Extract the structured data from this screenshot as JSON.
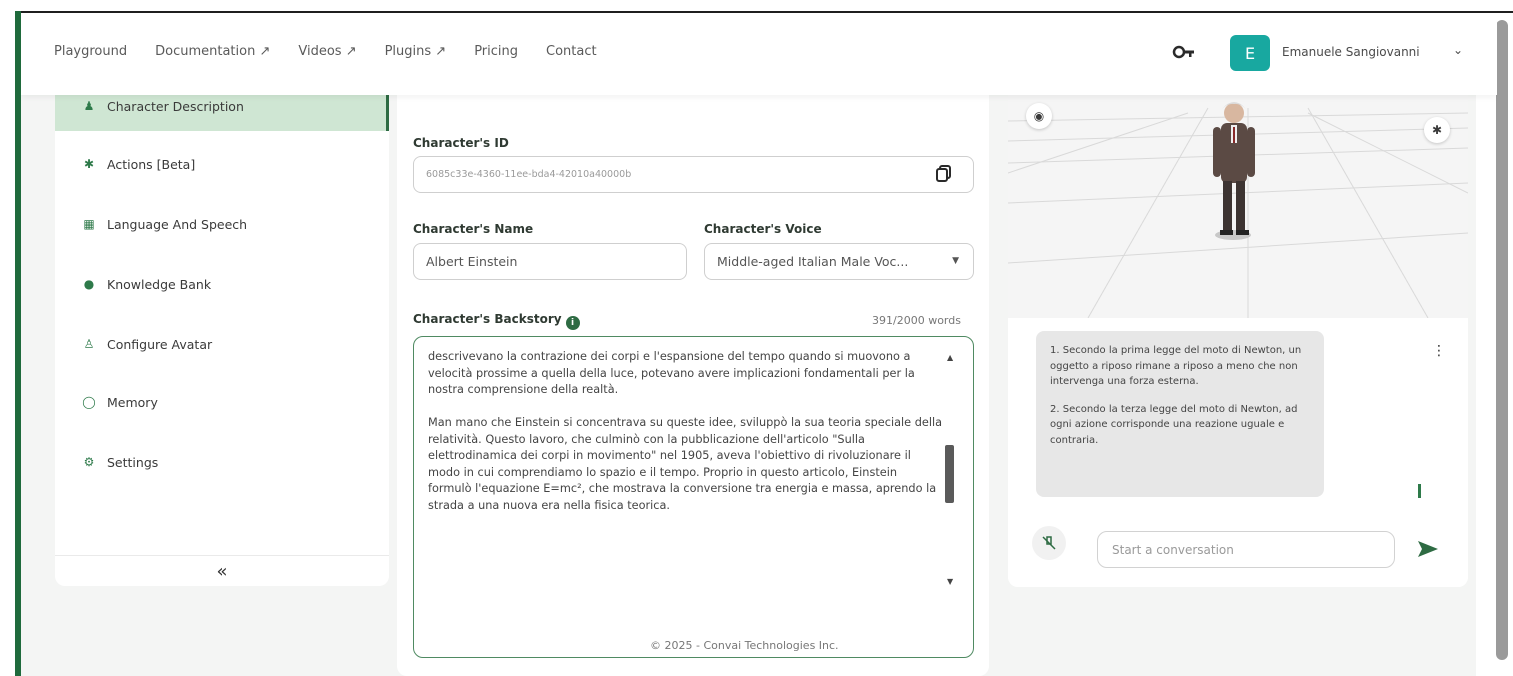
{
  "nav": {
    "links": [
      "Playground",
      "Documentation ↗",
      "Videos ↗",
      "Plugins ↗",
      "Pricing",
      "Contact"
    ],
    "user_initial": "E",
    "user_name": "Emanuele Sangiovanni",
    "avatar_color": "#18a8a0"
  },
  "sidebar": {
    "items": [
      {
        "label": "Character Description",
        "icon": "person-icon",
        "active": true
      },
      {
        "label": "Actions [Beta]",
        "icon": "running-icon",
        "active": false
      },
      {
        "label": "Language And Speech",
        "icon": "language-icon",
        "active": false
      },
      {
        "label": "Knowledge Bank",
        "icon": "lightbulb-icon",
        "active": false
      },
      {
        "label": "Configure Avatar",
        "icon": "avatar-icon",
        "active": false
      },
      {
        "label": "Memory",
        "icon": "memory-icon",
        "active": false
      },
      {
        "label": "Settings",
        "icon": "gear-icon",
        "active": false
      }
    ],
    "collapse_label": "«"
  },
  "form": {
    "id_label": "Character's ID",
    "id_value": "6085c33e-4360-11ee-bda4-42010a40000b",
    "name_label": "Character's Name",
    "name_value": "Albert Einstein",
    "voice_label": "Character's Voice",
    "voice_value": "Middle-aged Italian Male Voc...",
    "backstory_label": "Character's Backstory",
    "word_count": "391/2000 words",
    "backstory_paragraphs": [
      "descrivevano la contrazione dei corpi e l'espansione del tempo quando si muovono a velocità prossime a quella della luce, potevano avere implicazioni fondamentali per la nostra comprensione della realtà.",
      "Man mano che Einstein si concentrava su queste idee, sviluppò la sua teoria speciale della relatività. Questo lavoro, che culminò con la pubblicazione dell'articolo \"Sulla elettrodinamica dei corpi in movimento\" nel 1905, aveva l'obiettivo di rivoluzionare il modo in cui comprendiamo lo spazio e il tempo. Proprio in questo articolo, Einstein formulò l'equazione E=mc², che mostrava la conversione tra energia e massa, aprendo la strada a una nuova era nella fisica teorica."
    ],
    "copyright": "© 2025 - Convai Technologies Inc."
  },
  "chat": {
    "messages": [
      "1. Secondo la prima legge del moto di Newton, un oggetto a riposo rimane a riposo a meno che non intervenga una forza esterna.",
      "2. Secondo la terza legge del moto di Newton, ad ogni azione corrisponde una reazione uguale e contraria."
    ],
    "input_placeholder": "Start a conversation"
  },
  "colors": {
    "accent": "#2d6b43",
    "active_bg": "#cfe6d3"
  }
}
